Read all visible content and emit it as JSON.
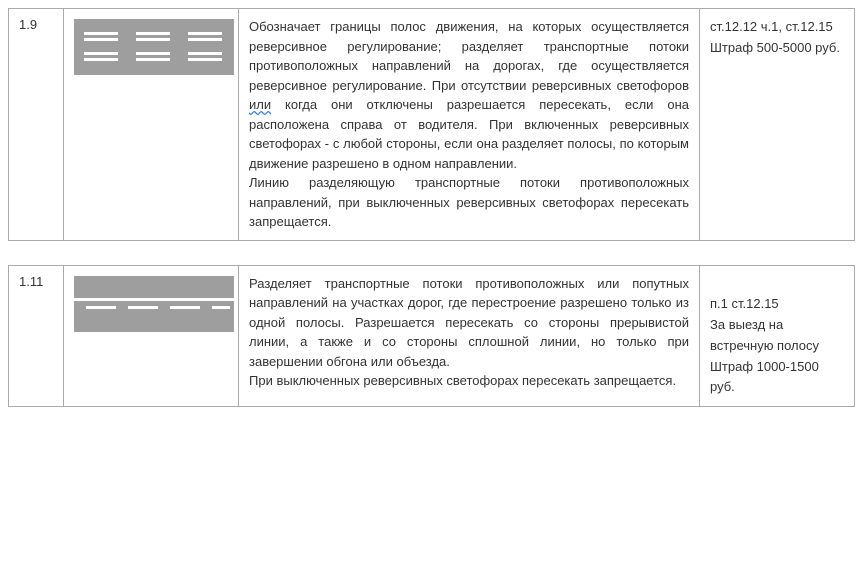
{
  "rows": [
    {
      "num": "1.9",
      "desc_pre": "Обозначает границы полос движения, на которых осуществляется реверсивное регулирование; разделяет транспортные потоки противоположных направлений на дорогах, где осуществляется реверсивное регулирование. При отсутствии реверсивных светофоров ",
      "underlined": "или",
      "desc_post": " когда они отключены разрешается пересекать, если она расположена справа от водителя. При включенных реверсивных светофорах - с любой стороны, если она разделяет полосы, по которым движение разрешено в одном направлении.",
      "desc_p2": "Линию разделяющую транспортные потоки противоположных направлений, при выключенных реверсивных светофорах пересекать запрещается.",
      "penalty_l1": "ст.12.12 ч.1, ст.12.15",
      "penalty_l2": "Штраф 500-5000 руб."
    },
    {
      "num": "1.11",
      "desc_p1": "Разделяет транспортные потоки противоположных или попутных направлений на участках дорог, где перестроение разрешено только из одной полосы. Разрешается пересекать со стороны прерывистой линии, а также и со стороны сплошной линии, но только при завершении обгона или объезда.",
      "desc_p2": "При выключенных реверсивных светофорах пересекать запрещается.",
      "penalty_l1": "п.1 ст.12.15",
      "penalty_l2": "За выезд на встречную полосу",
      "penalty_l3": "Штраф 1000-1500 руб."
    }
  ]
}
